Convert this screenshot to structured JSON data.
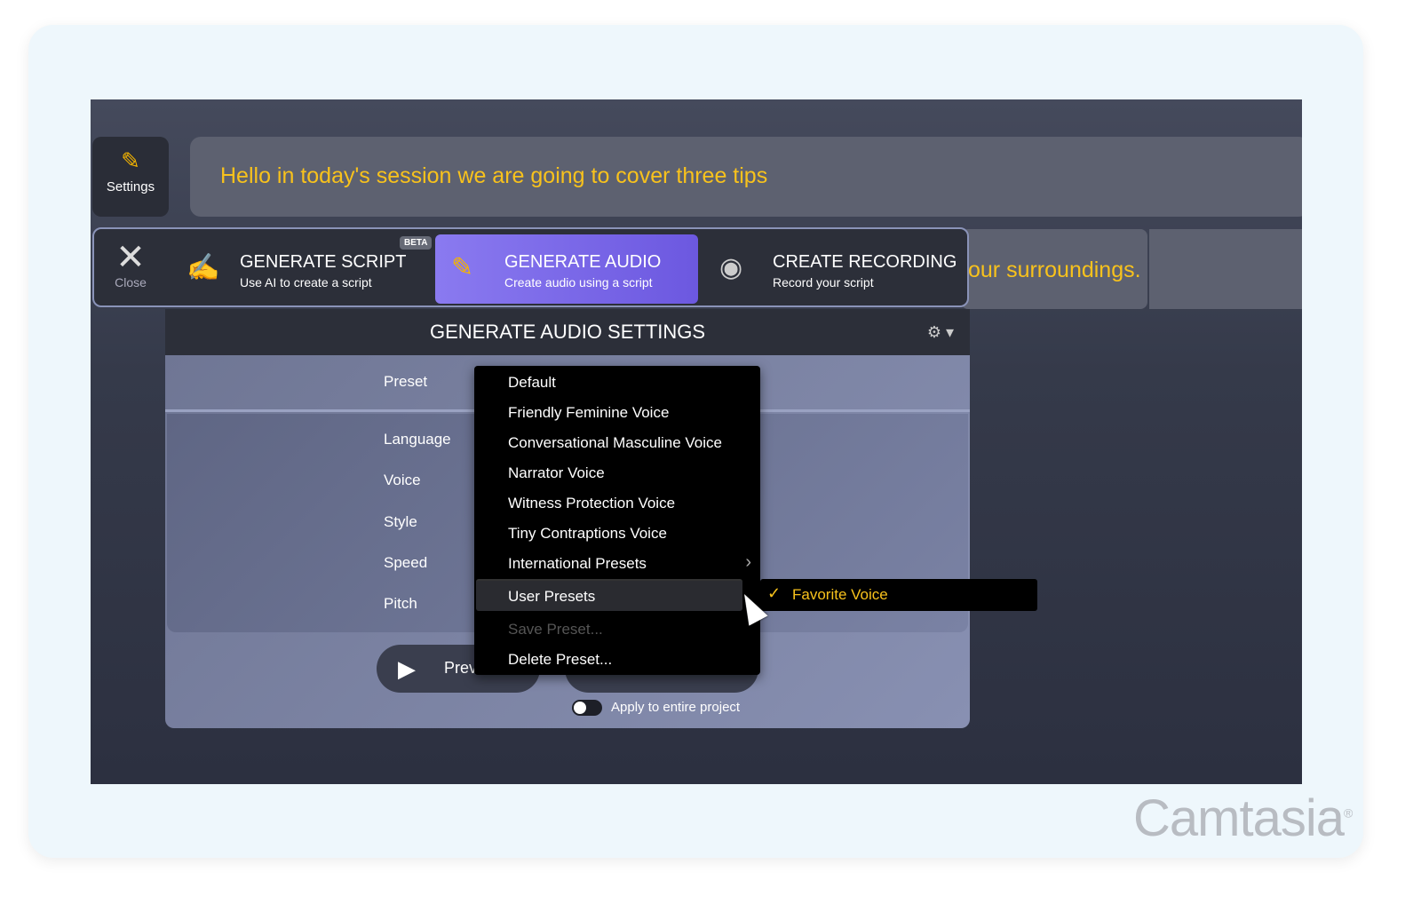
{
  "settings_button": {
    "label": "Settings"
  },
  "caption": {
    "line1": "Hello in today's session we are going to cover three tips",
    "line2": "our surroundings."
  },
  "toolbar": {
    "close_label": "Close",
    "tabs": [
      {
        "title": "GENERATE SCRIPT",
        "subtitle": "Use AI to create a script",
        "badge": "BETA",
        "icon": "script-pencil-icon"
      },
      {
        "title": "GENERATE AUDIO",
        "subtitle": "Create audio using a script",
        "icon": "audio-pencil-icon",
        "active": true
      },
      {
        "title": "CREATE RECORDING",
        "subtitle": "Record your script",
        "icon": "record-icon"
      }
    ]
  },
  "panel": {
    "title": "GENERATE AUDIO SETTINGS",
    "labels": [
      "Preset",
      "Language",
      "Voice",
      "Style",
      "Speed",
      "Pitch"
    ],
    "preview_label": "Prev",
    "apply_label": "Apply to entire project",
    "apply_toggle": false
  },
  "preset_menu": {
    "items": [
      "Default",
      "Friendly Feminine Voice",
      "Conversational Masculine Voice",
      "Narrator Voice",
      "Witness Protection Voice",
      "Tiny Contraptions Voice",
      "International Presets",
      "User Presets",
      "Save Preset...",
      "Delete Preset..."
    ],
    "disabled": [
      "Save Preset..."
    ],
    "highlighted": "User Presets"
  },
  "submenu": {
    "items": [
      "Favorite Voice"
    ],
    "checked": "Favorite Voice"
  },
  "watermark": "Camtasia",
  "colors": {
    "accent": "#7a68ea",
    "caption": "#f8c21c"
  }
}
